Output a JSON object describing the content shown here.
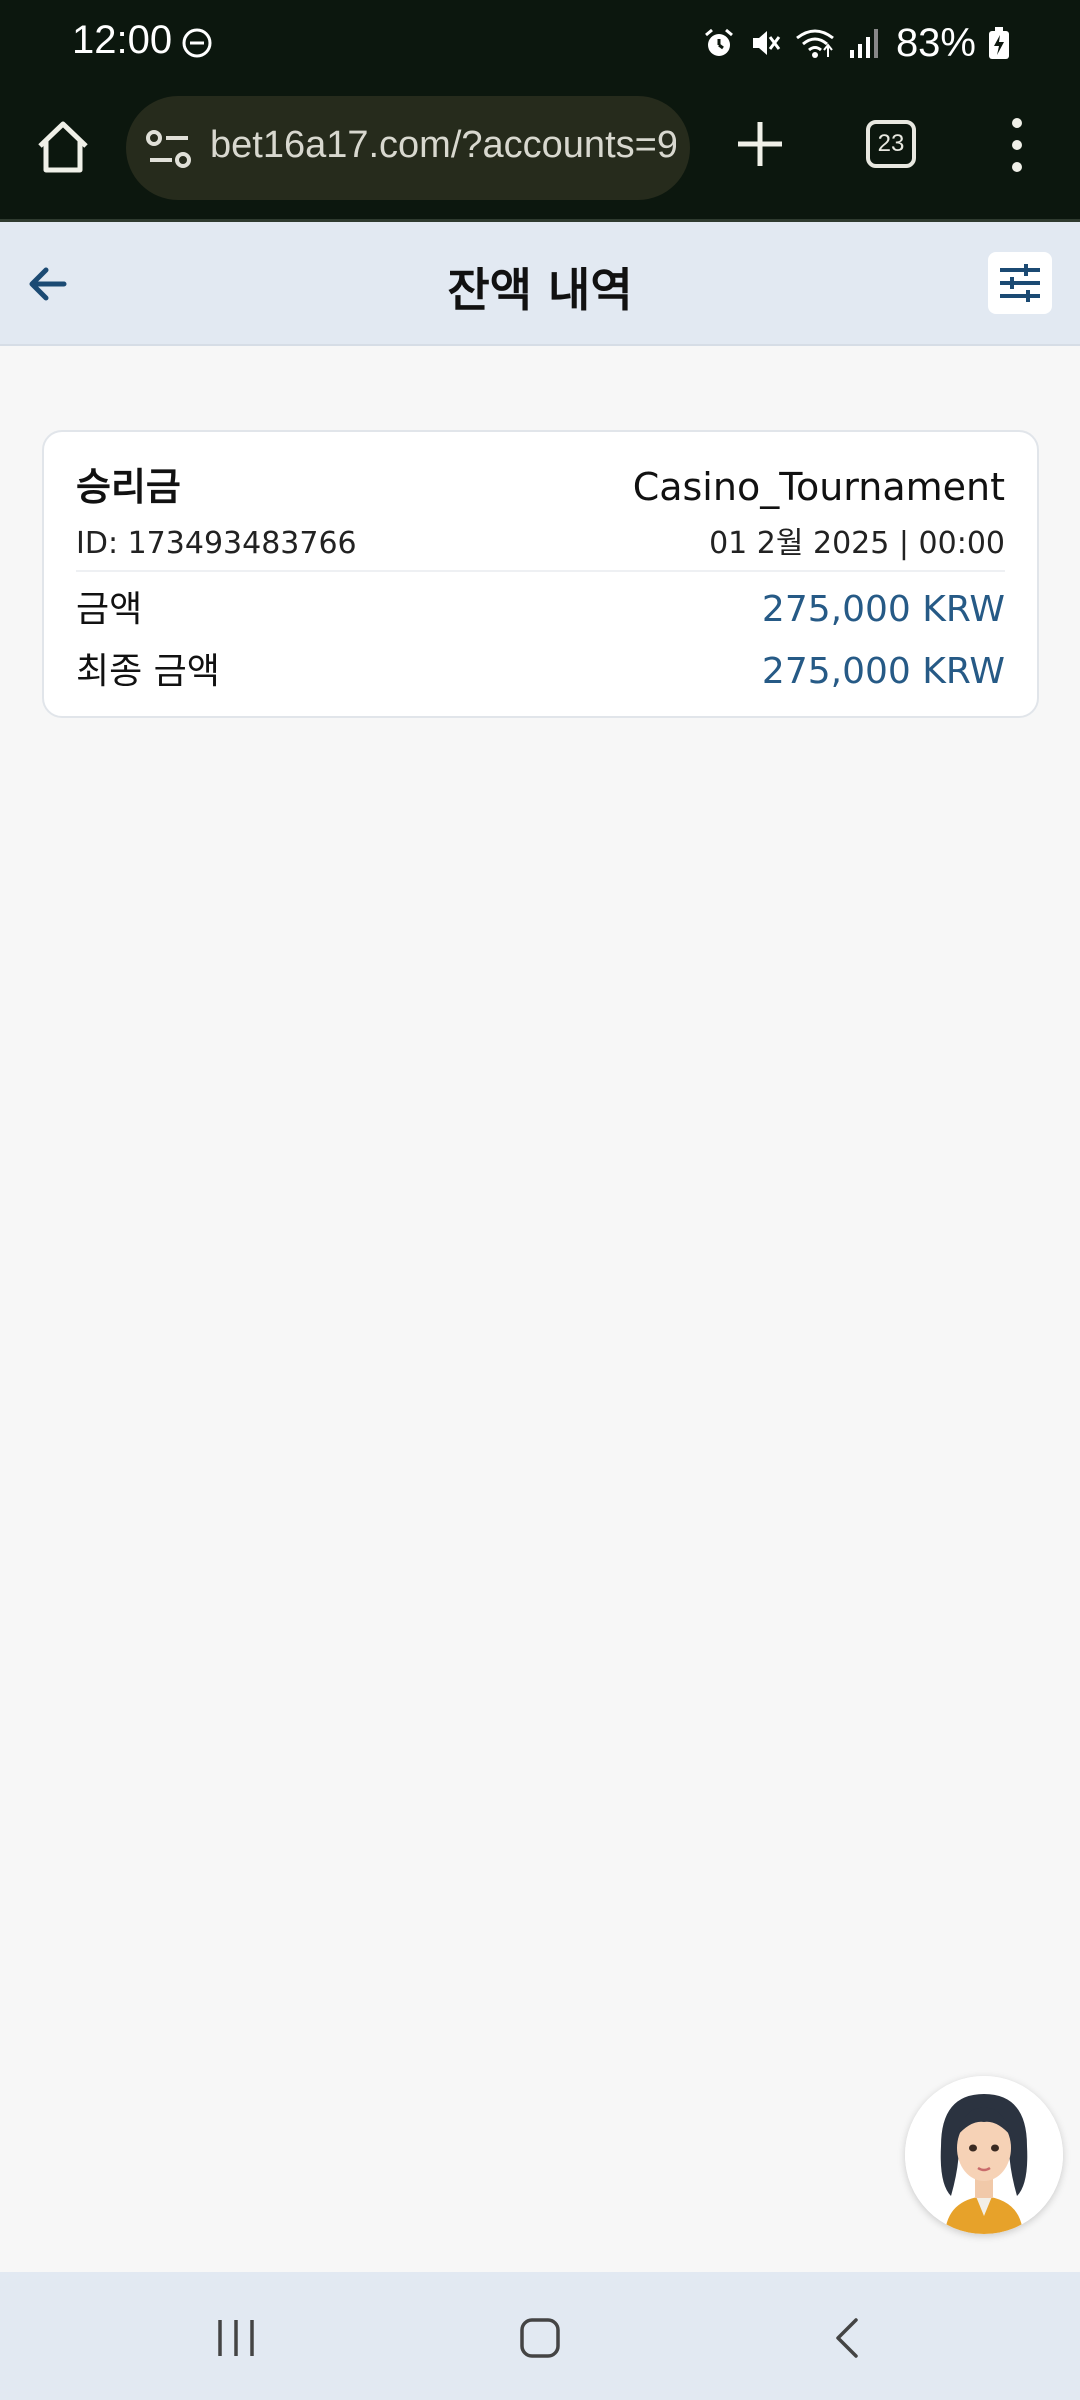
{
  "status_bar": {
    "time": "12:00",
    "battery": "83%",
    "icons": [
      "do-not-disturb-icon",
      "alarm-icon",
      "mute-icon",
      "wifi-icon",
      "signal-icon",
      "battery-charging-icon"
    ]
  },
  "browser": {
    "url": "bet16a17.com/?accounts=9",
    "tab_count": "23",
    "icons": [
      "home-icon",
      "site-info-icon",
      "plus-icon",
      "tabs-icon",
      "kebab-menu-icon"
    ]
  },
  "header": {
    "title": "잔액 내역",
    "icons": [
      "arrow-left-icon",
      "sliders-icon"
    ]
  },
  "transactions": [
    {
      "type": "승리금",
      "game": "Casino_Tournament",
      "id": "ID: 173493483766",
      "date": "01 2월 2025 | 00:00",
      "amount_label": "금액",
      "amount": "275,000 KRW",
      "final_label": "최종 금액",
      "final_amount": "275,000 KRW"
    }
  ],
  "colors": {
    "system_bar": "#0c170e",
    "header_bg": "#e2e9f2",
    "amount": "#265a86",
    "page_bg": "#f7f7f7"
  },
  "nav": {
    "icons": [
      "recent-apps-icon",
      "home-nav-icon",
      "back-nav-icon"
    ]
  }
}
